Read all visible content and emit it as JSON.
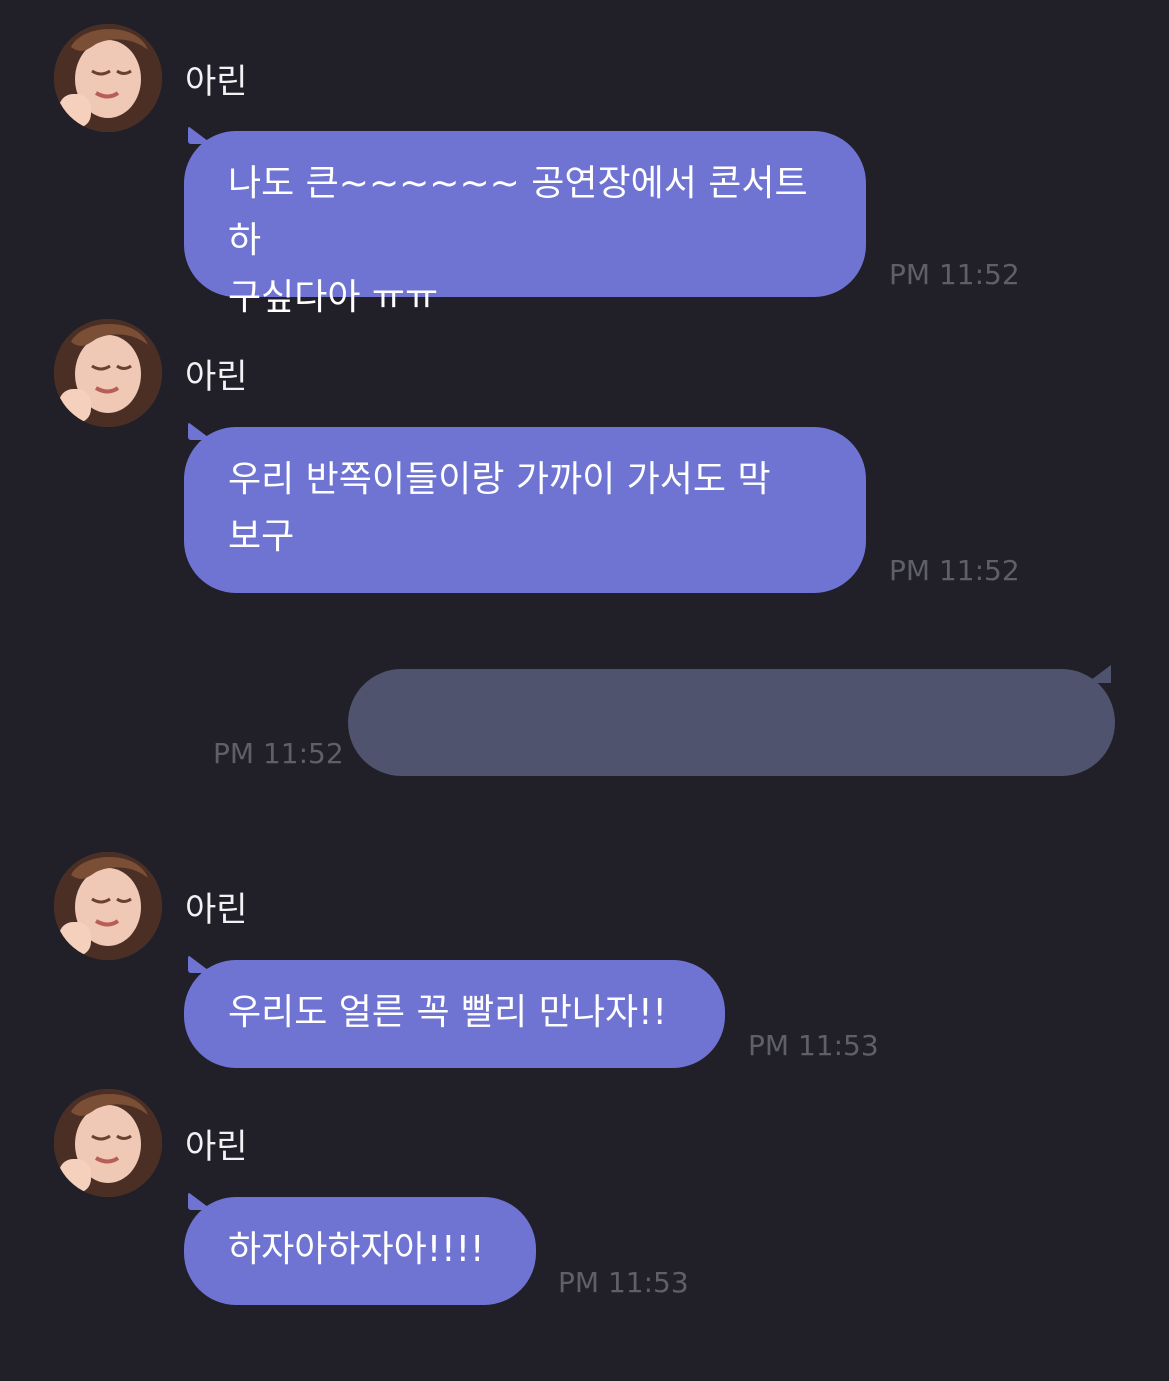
{
  "chat": {
    "messages": [
      {
        "sender": "아린",
        "avatar_icon": "profile-photo-icon",
        "line1": "나도 큰~~~~~~ 공연장에서 콘서트 하",
        "line2": "구싶다아 ㅠㅠ",
        "time": "PM 11:52"
      },
      {
        "sender": "아린",
        "avatar_icon": "profile-photo-icon",
        "line1": "우리 반쪽이들이랑 가까이 가서도 막",
        "line2": "보구",
        "time": "PM 11:52"
      },
      {
        "sender": "me",
        "text": "",
        "time": "PM 11:52"
      },
      {
        "sender": "아린",
        "avatar_icon": "profile-photo-icon",
        "text": "우리도 얼른 꼭 빨리 만나자!!",
        "time": "PM 11:53"
      },
      {
        "sender": "아린",
        "avatar_icon": "profile-photo-icon",
        "text": "하자아하자아!!!!",
        "time": "PM 11:53"
      }
    ]
  },
  "colors": {
    "background": "#212029",
    "incoming_bubble": "#6f74d3",
    "outgoing_bubble": "#4f536e",
    "timestamp": "#5f5f68",
    "name_text": "#f2f2f4"
  }
}
